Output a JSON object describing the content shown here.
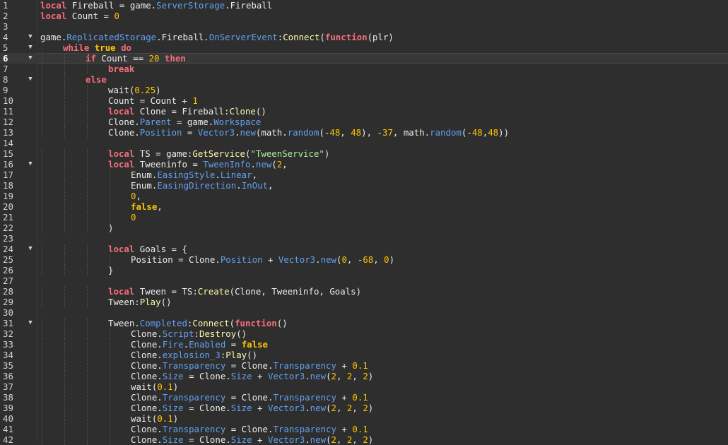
{
  "editor": {
    "current_line": 6,
    "fold_icon": "chevron-down-icon",
    "colors": {
      "background": "#2e2e2e",
      "keyword": "#f86d7c",
      "number": "#ffc600",
      "string": "#adf195",
      "property": "#61a1f1",
      "method": "#fdfbac",
      "text": "#ececec"
    },
    "lines": [
      {
        "n": "1",
        "fold": false,
        "indent": 0,
        "tokens": [
          [
            "kw",
            "local"
          ],
          [
            "t",
            " Fireball = game."
          ],
          [
            "p",
            "ServerStorage"
          ],
          [
            "t",
            ".Fireball"
          ]
        ]
      },
      {
        "n": "2",
        "fold": false,
        "indent": 0,
        "tokens": [
          [
            "kw",
            "local"
          ],
          [
            "t",
            " Count = "
          ],
          [
            "num",
            "0"
          ]
        ]
      },
      {
        "n": "3",
        "fold": false,
        "indent": 0,
        "tokens": []
      },
      {
        "n": "4",
        "fold": true,
        "indent": 0,
        "tokens": [
          [
            "t",
            "game."
          ],
          [
            "p",
            "ReplicatedStorage"
          ],
          [
            "t",
            ".Fireball."
          ],
          [
            "p",
            "OnServerEvent"
          ],
          [
            "t",
            ":"
          ],
          [
            "fn",
            "Connect"
          ],
          [
            "t",
            "("
          ],
          [
            "kw",
            "function"
          ],
          [
            "t",
            "(plr)"
          ]
        ]
      },
      {
        "n": "5",
        "fold": true,
        "indent": 1,
        "tokens": [
          [
            "kw",
            "while"
          ],
          [
            "t",
            " "
          ],
          [
            "bool",
            "true"
          ],
          [
            "t",
            " "
          ],
          [
            "kw",
            "do"
          ]
        ]
      },
      {
        "n": "6",
        "fold": true,
        "indent": 2,
        "tokens": [
          [
            "kw",
            "if"
          ],
          [
            "t",
            " Count == "
          ],
          [
            "num",
            "20"
          ],
          [
            "t",
            " "
          ],
          [
            "kw",
            "then"
          ]
        ]
      },
      {
        "n": "7",
        "fold": false,
        "indent": 3,
        "tokens": [
          [
            "kw",
            "break"
          ]
        ]
      },
      {
        "n": "8",
        "fold": true,
        "indent": 2,
        "tokens": [
          [
            "kw",
            "else"
          ]
        ]
      },
      {
        "n": "9",
        "fold": false,
        "indent": 3,
        "tokens": [
          [
            "t",
            "wait("
          ],
          [
            "num",
            "0.25"
          ],
          [
            "t",
            ")"
          ]
        ]
      },
      {
        "n": "10",
        "fold": false,
        "indent": 3,
        "tokens": [
          [
            "t",
            "Count = Count + "
          ],
          [
            "num",
            "1"
          ]
        ]
      },
      {
        "n": "11",
        "fold": false,
        "indent": 3,
        "tokens": [
          [
            "kw",
            "local"
          ],
          [
            "t",
            " Clone = Fireball:"
          ],
          [
            "fn",
            "Clone"
          ],
          [
            "t",
            "()"
          ]
        ]
      },
      {
        "n": "12",
        "fold": false,
        "indent": 3,
        "tokens": [
          [
            "t",
            "Clone."
          ],
          [
            "p",
            "Parent"
          ],
          [
            "t",
            " = game."
          ],
          [
            "p",
            "Workspace"
          ]
        ]
      },
      {
        "n": "13",
        "fold": false,
        "indent": 3,
        "tokens": [
          [
            "t",
            "Clone."
          ],
          [
            "p",
            "Position"
          ],
          [
            "t",
            " = "
          ],
          [
            "p",
            "Vector3"
          ],
          [
            "t",
            "."
          ],
          [
            "p",
            "new"
          ],
          [
            "t",
            "(math."
          ],
          [
            "p",
            "random"
          ],
          [
            "t",
            "(-"
          ],
          [
            "num",
            "48"
          ],
          [
            "t",
            ", "
          ],
          [
            "num",
            "48"
          ],
          [
            "t",
            "), -"
          ],
          [
            "num",
            "37"
          ],
          [
            "t",
            ", math."
          ],
          [
            "p",
            "random"
          ],
          [
            "t",
            "(-"
          ],
          [
            "num",
            "48"
          ],
          [
            "t",
            ","
          ],
          [
            "num",
            "48"
          ],
          [
            "t",
            "))"
          ]
        ]
      },
      {
        "n": "14",
        "fold": false,
        "indent": 0,
        "tokens": []
      },
      {
        "n": "15",
        "fold": false,
        "indent": 3,
        "tokens": [
          [
            "kw",
            "local"
          ],
          [
            "t",
            " TS = game:"
          ],
          [
            "fn",
            "GetService"
          ],
          [
            "t",
            "("
          ],
          [
            "str",
            "\"TweenService\""
          ],
          [
            "t",
            ")"
          ]
        ]
      },
      {
        "n": "16",
        "fold": true,
        "indent": 3,
        "tokens": [
          [
            "kw",
            "local"
          ],
          [
            "t",
            " Tweeninfo = "
          ],
          [
            "p",
            "TweenInfo"
          ],
          [
            "t",
            "."
          ],
          [
            "p",
            "new"
          ],
          [
            "t",
            "("
          ],
          [
            "num",
            "2"
          ],
          [
            "t",
            ","
          ]
        ]
      },
      {
        "n": "17",
        "fold": false,
        "indent": 4,
        "tokens": [
          [
            "t",
            "Enum."
          ],
          [
            "p",
            "EasingStyle"
          ],
          [
            "t",
            "."
          ],
          [
            "p",
            "Linear"
          ],
          [
            "t",
            ","
          ]
        ]
      },
      {
        "n": "18",
        "fold": false,
        "indent": 4,
        "tokens": [
          [
            "t",
            "Enum."
          ],
          [
            "p",
            "EasingDirection"
          ],
          [
            "t",
            "."
          ],
          [
            "p",
            "InOut"
          ],
          [
            "t",
            ","
          ]
        ]
      },
      {
        "n": "19",
        "fold": false,
        "indent": 4,
        "tokens": [
          [
            "num",
            "0"
          ],
          [
            "t",
            ","
          ]
        ]
      },
      {
        "n": "20",
        "fold": false,
        "indent": 4,
        "tokens": [
          [
            "bool",
            "false"
          ],
          [
            "t",
            ","
          ]
        ]
      },
      {
        "n": "21",
        "fold": false,
        "indent": 4,
        "tokens": [
          [
            "num",
            "0"
          ]
        ]
      },
      {
        "n": "22",
        "fold": false,
        "indent": 3,
        "tokens": [
          [
            "t",
            ")"
          ]
        ]
      },
      {
        "n": "23",
        "fold": false,
        "indent": 0,
        "tokens": []
      },
      {
        "n": "24",
        "fold": true,
        "indent": 3,
        "tokens": [
          [
            "kw",
            "local"
          ],
          [
            "t",
            " Goals = {"
          ]
        ]
      },
      {
        "n": "25",
        "fold": false,
        "indent": 4,
        "tokens": [
          [
            "t",
            "Position = Clone."
          ],
          [
            "p",
            "Position"
          ],
          [
            "t",
            " + "
          ],
          [
            "p",
            "Vector3"
          ],
          [
            "t",
            "."
          ],
          [
            "p",
            "new"
          ],
          [
            "t",
            "("
          ],
          [
            "num",
            "0"
          ],
          [
            "t",
            ", -"
          ],
          [
            "num",
            "68"
          ],
          [
            "t",
            ", "
          ],
          [
            "num",
            "0"
          ],
          [
            "t",
            ")"
          ]
        ]
      },
      {
        "n": "26",
        "fold": false,
        "indent": 3,
        "tokens": [
          [
            "t",
            "}"
          ]
        ]
      },
      {
        "n": "27",
        "fold": false,
        "indent": 0,
        "tokens": []
      },
      {
        "n": "28",
        "fold": false,
        "indent": 3,
        "tokens": [
          [
            "kw",
            "local"
          ],
          [
            "t",
            " Tween = TS:"
          ],
          [
            "fn",
            "Create"
          ],
          [
            "t",
            "(Clone, Tweeninfo, Goals)"
          ]
        ]
      },
      {
        "n": "29",
        "fold": false,
        "indent": 3,
        "tokens": [
          [
            "t",
            "Tween:"
          ],
          [
            "fn",
            "Play"
          ],
          [
            "t",
            "()"
          ]
        ]
      },
      {
        "n": "30",
        "fold": false,
        "indent": 0,
        "tokens": []
      },
      {
        "n": "31",
        "fold": true,
        "indent": 3,
        "tokens": [
          [
            "t",
            "Tween."
          ],
          [
            "p",
            "Completed"
          ],
          [
            "t",
            ":"
          ],
          [
            "fn",
            "Connect"
          ],
          [
            "t",
            "("
          ],
          [
            "kw",
            "function"
          ],
          [
            "t",
            "()"
          ]
        ]
      },
      {
        "n": "32",
        "fold": false,
        "indent": 4,
        "tokens": [
          [
            "t",
            "Clone."
          ],
          [
            "p",
            "Script"
          ],
          [
            "t",
            ":"
          ],
          [
            "fn",
            "Destroy"
          ],
          [
            "t",
            "()"
          ]
        ]
      },
      {
        "n": "33",
        "fold": false,
        "indent": 4,
        "tokens": [
          [
            "t",
            "Clone."
          ],
          [
            "p",
            "Fire"
          ],
          [
            "t",
            "."
          ],
          [
            "p",
            "Enabled"
          ],
          [
            "t",
            " = "
          ],
          [
            "bool",
            "false"
          ]
        ]
      },
      {
        "n": "34",
        "fold": false,
        "indent": 4,
        "tokens": [
          [
            "t",
            "Clone."
          ],
          [
            "p",
            "explosion_3"
          ],
          [
            "t",
            ":"
          ],
          [
            "fn",
            "Play"
          ],
          [
            "t",
            "()"
          ]
        ]
      },
      {
        "n": "35",
        "fold": false,
        "indent": 4,
        "tokens": [
          [
            "t",
            "Clone."
          ],
          [
            "p",
            "Transparency"
          ],
          [
            "t",
            " = Clone."
          ],
          [
            "p",
            "Transparency"
          ],
          [
            "t",
            " + "
          ],
          [
            "num",
            "0.1"
          ]
        ]
      },
      {
        "n": "36",
        "fold": false,
        "indent": 4,
        "tokens": [
          [
            "t",
            "Clone."
          ],
          [
            "p",
            "Size"
          ],
          [
            "t",
            " = Clone."
          ],
          [
            "p",
            "Size"
          ],
          [
            "t",
            " + "
          ],
          [
            "p",
            "Vector3"
          ],
          [
            "t",
            "."
          ],
          [
            "p",
            "new"
          ],
          [
            "t",
            "("
          ],
          [
            "num",
            "2"
          ],
          [
            "t",
            ", "
          ],
          [
            "num",
            "2"
          ],
          [
            "t",
            ", "
          ],
          [
            "num",
            "2"
          ],
          [
            "t",
            ")"
          ]
        ]
      },
      {
        "n": "37",
        "fold": false,
        "indent": 4,
        "tokens": [
          [
            "t",
            "wait("
          ],
          [
            "num",
            "0.1"
          ],
          [
            "t",
            ")"
          ]
        ]
      },
      {
        "n": "38",
        "fold": false,
        "indent": 4,
        "tokens": [
          [
            "t",
            "Clone."
          ],
          [
            "p",
            "Transparency"
          ],
          [
            "t",
            " = Clone."
          ],
          [
            "p",
            "Transparency"
          ],
          [
            "t",
            " + "
          ],
          [
            "num",
            "0.1"
          ]
        ]
      },
      {
        "n": "39",
        "fold": false,
        "indent": 4,
        "tokens": [
          [
            "t",
            "Clone."
          ],
          [
            "p",
            "Size"
          ],
          [
            "t",
            " = Clone."
          ],
          [
            "p",
            "Size"
          ],
          [
            "t",
            " + "
          ],
          [
            "p",
            "Vector3"
          ],
          [
            "t",
            "."
          ],
          [
            "p",
            "new"
          ],
          [
            "t",
            "("
          ],
          [
            "num",
            "2"
          ],
          [
            "t",
            ", "
          ],
          [
            "num",
            "2"
          ],
          [
            "t",
            ", "
          ],
          [
            "num",
            "2"
          ],
          [
            "t",
            ")"
          ]
        ]
      },
      {
        "n": "40",
        "fold": false,
        "indent": 4,
        "tokens": [
          [
            "t",
            "wait("
          ],
          [
            "num",
            "0.1"
          ],
          [
            "t",
            ")"
          ]
        ]
      },
      {
        "n": "41",
        "fold": false,
        "indent": 4,
        "tokens": [
          [
            "t",
            "Clone."
          ],
          [
            "p",
            "Transparency"
          ],
          [
            "t",
            " = Clone."
          ],
          [
            "p",
            "Transparency"
          ],
          [
            "t",
            " + "
          ],
          [
            "num",
            "0.1"
          ]
        ]
      },
      {
        "n": "42",
        "fold": false,
        "indent": 4,
        "tokens": [
          [
            "t",
            "Clone."
          ],
          [
            "p",
            "Size"
          ],
          [
            "t",
            " = Clone."
          ],
          [
            "p",
            "Size"
          ],
          [
            "t",
            " + "
          ],
          [
            "p",
            "Vector3"
          ],
          [
            "t",
            "."
          ],
          [
            "p",
            "new"
          ],
          [
            "t",
            "("
          ],
          [
            "num",
            "2"
          ],
          [
            "t",
            ", "
          ],
          [
            "num",
            "2"
          ],
          [
            "t",
            ", "
          ],
          [
            "num",
            "2"
          ],
          [
            "t",
            ")"
          ]
        ]
      }
    ]
  }
}
